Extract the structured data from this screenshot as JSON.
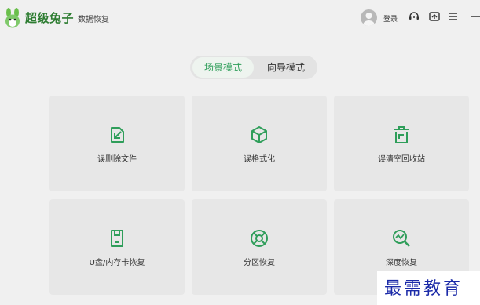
{
  "app": {
    "title": "超级兔子",
    "subtitle": "数据恢复"
  },
  "header": {
    "login_label": "登录",
    "icons": [
      "user-avatar-icon",
      "support-chat-icon",
      "share-icon",
      "menu-icon",
      "minimize-icon"
    ]
  },
  "tabs": [
    {
      "label": "场景模式",
      "active": true
    },
    {
      "label": "向导模式",
      "active": false
    }
  ],
  "cards": [
    {
      "label": "误删除文件",
      "icon": "deleted-file-icon"
    },
    {
      "label": "误格式化",
      "icon": "box-format-icon"
    },
    {
      "label": "误清空回收站",
      "icon": "recycle-bin-icon"
    },
    {
      "label": "U盘/内存卡恢复",
      "icon": "sd-card-icon"
    },
    {
      "label": "分区恢复",
      "icon": "partition-icon"
    },
    {
      "label": "深度恢复",
      "icon": "deep-search-icon"
    }
  ],
  "watermark": "最需教育",
  "colors": {
    "accent": "#2f9e5a",
    "background": "#f0f0f0",
    "card": "#e7e7e7",
    "watermark": "#1b2aa8"
  }
}
